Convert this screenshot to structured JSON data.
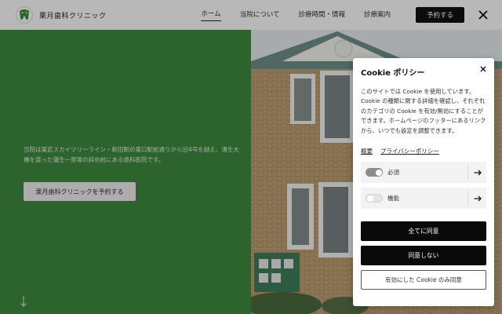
{
  "header": {
    "logo_text": "栗月歯科クリニック",
    "nav": [
      {
        "label": "ホーム",
        "active": true
      },
      {
        "label": "当院について",
        "active": false
      },
      {
        "label": "診療時間・情報",
        "active": false
      },
      {
        "label": "診療案内",
        "active": false
      }
    ],
    "reserve_label": "予約する",
    "social_icon": "x-icon"
  },
  "hero": {
    "description": "当院は東武スカイツリーライン・新田駅の東口駅前通りから旧4号を越え、湧生大橋を渡った蒲生一里塚の斜め前にある歯科医院です。",
    "button_label": "栗月歯科クリニックを予約する",
    "background_color": "#3f8a3f"
  },
  "cookie": {
    "title": "Cookie ポリシー",
    "body": "このサイトでは Cookie を使用しています。Cookie の種類に関する詳細を確認し、それぞれのカテゴリの Cookie を有効/無効にすることができます。ホームページのフッターにあるリンクから、いつでも設定を調整できます。",
    "links": [
      "概要",
      "プライバシーポリシー"
    ],
    "categories": [
      {
        "label": "必須",
        "enabled": true
      },
      {
        "label": "機能",
        "enabled": false
      }
    ],
    "accept_all_label": "全てに同意",
    "decline_label": "同意しない",
    "accept_enabled_label": "有効にした Cookie のみ同意"
  }
}
